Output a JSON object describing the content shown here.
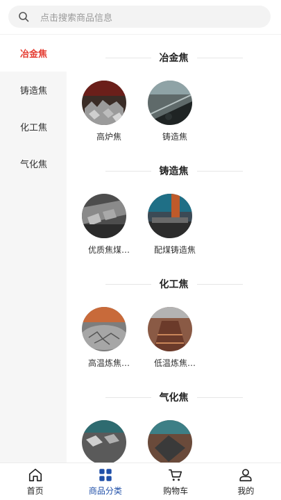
{
  "search": {
    "placeholder": "点击搜索商品信息"
  },
  "sidebar": {
    "items": [
      {
        "label": "冶金焦",
        "active": true
      },
      {
        "label": "铸造焦",
        "active": false
      },
      {
        "label": "化工焦",
        "active": false
      },
      {
        "label": "气化焦",
        "active": false
      }
    ]
  },
  "sections": [
    {
      "title": "冶金焦",
      "items": [
        {
          "label": "高炉焦"
        },
        {
          "label": "铸造焦"
        }
      ]
    },
    {
      "title": "铸造焦",
      "items": [
        {
          "label": "优质焦煤…"
        },
        {
          "label": "配煤铸造焦"
        }
      ]
    },
    {
      "title": "化工焦",
      "items": [
        {
          "label": "高温炼焦…"
        },
        {
          "label": "低温炼焦…"
        }
      ]
    },
    {
      "title": "气化焦",
      "items": [
        {
          "label": ""
        },
        {
          "label": ""
        }
      ]
    }
  ],
  "tabbar": {
    "tabs": [
      {
        "label": "首页",
        "icon": "home-icon"
      },
      {
        "label": "商品分类",
        "icon": "category-icon",
        "active": true
      },
      {
        "label": "购物车",
        "icon": "cart-icon"
      },
      {
        "label": "我的",
        "icon": "user-icon"
      }
    ]
  },
  "colors": {
    "accent_red": "#e43a2f",
    "accent_blue": "#1f4fa8",
    "sidebar_bg": "#f6f6f6"
  }
}
